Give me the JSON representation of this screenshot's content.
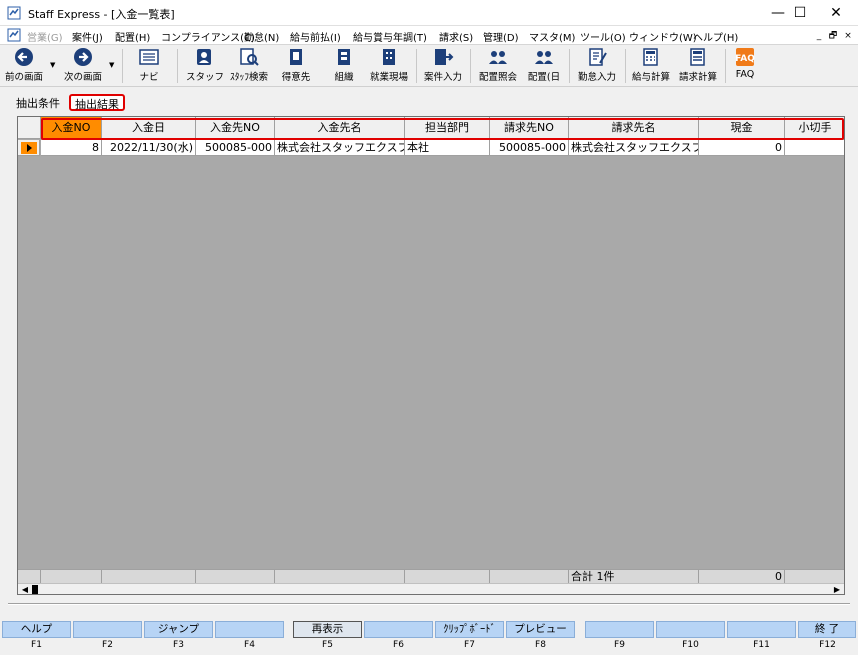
{
  "window": {
    "title": "Staff Express - [入金一覧表]",
    "minimize": "—",
    "maximize": "☐",
    "close": "✕"
  },
  "menu": {
    "items": [
      {
        "label": "営業(G)",
        "disabled": true
      },
      {
        "label": "案件(J)"
      },
      {
        "label": "配置(H)"
      },
      {
        "label": "コンプライアンス(C)"
      },
      {
        "label": "勤怠(N)"
      },
      {
        "label": "給与前払(I)"
      },
      {
        "label": "給与賞与年調(T)"
      },
      {
        "label": "請求(S)"
      },
      {
        "label": "管理(D)"
      },
      {
        "label": "マスタ(M)"
      },
      {
        "label": "ツール(O)"
      },
      {
        "label": "ウィンドウ(W)"
      },
      {
        "label": "ヘルプ(H)"
      }
    ],
    "mdi": [
      "_",
      "🗗",
      "×"
    ]
  },
  "toolbar": {
    "buttons": [
      {
        "label": "前の画面",
        "icon": "back-arrow-icon"
      },
      {
        "label": "次の画面",
        "icon": "forward-arrow-icon"
      },
      {
        "label": "ナビ",
        "icon": "keyboard-icon"
      },
      {
        "label": "スタッフ",
        "icon": "staff-icon"
      },
      {
        "label": "ｽﾀｯﾌ検索",
        "icon": "staff-search-icon"
      },
      {
        "label": "得意先",
        "icon": "customer-icon"
      },
      {
        "label": "組織",
        "icon": "organization-icon"
      },
      {
        "label": "就業現場",
        "icon": "workplace-icon"
      },
      {
        "label": "案件入力",
        "icon": "project-input-icon"
      },
      {
        "label": "配置照会",
        "icon": "placement-inquiry-icon"
      },
      {
        "label": "配置(日",
        "icon": "placement-day-icon"
      },
      {
        "label": "勤怠入力",
        "icon": "attendance-input-icon"
      },
      {
        "label": "給与計算",
        "icon": "payroll-calc-icon"
      },
      {
        "label": "請求計算",
        "icon": "billing-calc-icon"
      },
      {
        "label": "FAQ",
        "icon": "faq-icon"
      }
    ]
  },
  "tabs": [
    {
      "label": "抽出条件"
    },
    {
      "label": "抽出結果"
    }
  ],
  "grid": {
    "columns": [
      "入金NO",
      "入金日",
      "入金先NO",
      "入金先名",
      "担当部門",
      "請求先NO",
      "請求先名",
      "現金",
      "小切手"
    ],
    "rows": [
      [
        "8",
        "2022/11/30(水)",
        "500085-000",
        "株式会社スタッフエクスプレス",
        "本社",
        "500085-000",
        "株式会社スタッフエクスプレス",
        "0",
        ""
      ]
    ],
    "total_label": "合計 1件",
    "total_cash": "0"
  },
  "fkeys": [
    {
      "label": "ヘルプ",
      "key": "F1"
    },
    {
      "label": "",
      "key": "F2"
    },
    {
      "label": "ジャンプ",
      "key": "F3"
    },
    {
      "label": "",
      "key": "F4"
    },
    {
      "label": "再表示",
      "key": "F5"
    },
    {
      "label": "",
      "key": "F6"
    },
    {
      "label": "ｸﾘｯﾌﾟﾎﾞｰﾄﾞ",
      "key": "F7"
    },
    {
      "label": "プレビュー",
      "key": "F8"
    },
    {
      "label": "",
      "key": "F9"
    },
    {
      "label": "",
      "key": "F10"
    },
    {
      "label": "",
      "key": "F11"
    },
    {
      "label": "終 了",
      "key": "F12"
    }
  ],
  "colors": {
    "selected_header": "#ff8c00",
    "highlight_outline": "#e00000",
    "fkey_bg": "#b7d4f5",
    "grid_bg": "#a9a9a9"
  }
}
